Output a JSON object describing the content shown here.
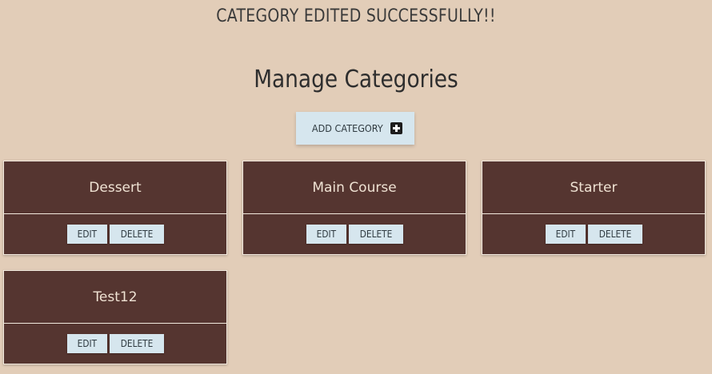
{
  "flash_message": "CATEGORY EDITED SUCCESSFULLY!!",
  "page_title": "Manage Categories",
  "add_button": {
    "label": "ADD CATEGORY",
    "icon": "plus-square-icon"
  },
  "categories": [
    {
      "name": "Dessert",
      "edit_label": "EDIT",
      "delete_label": "DELETE"
    },
    {
      "name": "Main Course",
      "edit_label": "EDIT",
      "delete_label": "DELETE"
    },
    {
      "name": "Starter",
      "edit_label": "EDIT",
      "delete_label": "DELETE"
    },
    {
      "name": "Test12",
      "edit_label": "EDIT",
      "delete_label": "DELETE"
    }
  ],
  "colors": {
    "background": "#e2cdb8",
    "card": "#553530",
    "button": "#d6e6ee"
  }
}
